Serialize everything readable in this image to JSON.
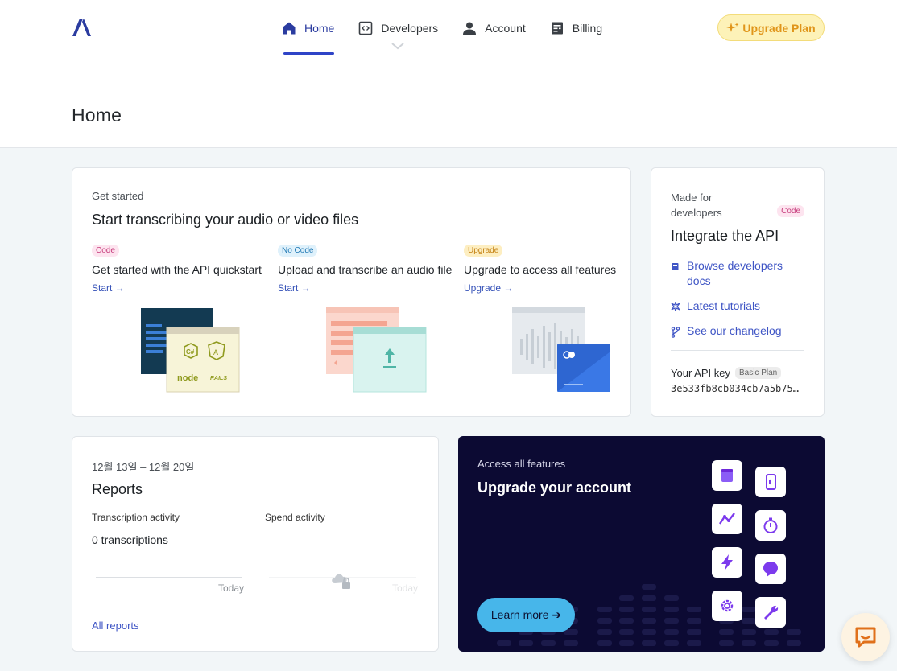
{
  "colors": {
    "brand": "#2f44c7",
    "link": "#3f55c5",
    "upgrade_bg": "#fdf2b8",
    "upgrade_text": "#e0951a",
    "promo_bg": "#0c0a33",
    "cta": "#47b6ea"
  },
  "nav": {
    "logo_icon": "assemblyai-logo-icon",
    "items": [
      {
        "label": "Home",
        "icon": "home-icon",
        "active": true
      },
      {
        "label": "Developers",
        "icon": "code-window-icon",
        "active": false
      },
      {
        "label": "Account",
        "icon": "person-icon",
        "active": false
      },
      {
        "label": "Billing",
        "icon": "receipt-icon",
        "active": false
      }
    ],
    "upgrade_label": "Upgrade Plan",
    "upgrade_icon": "sparkle-icon"
  },
  "page": {
    "title": "Home"
  },
  "get_started": {
    "eyebrow": "Get started",
    "title": "Start transcribing your audio or video files",
    "columns": [
      {
        "tag": "Code",
        "title": "Get started with the API quickstart",
        "link": "Start →"
      },
      {
        "tag": "No Code",
        "title": "Upload and transcribe an audio file",
        "link": "Start →"
      },
      {
        "tag": "Upgrade",
        "title": "Upgrade to access all features",
        "link": "Upgrade →"
      }
    ],
    "sdk_logos": [
      "C#",
      "node",
      "RAILS"
    ]
  },
  "api": {
    "eyebrow": "Made for developers",
    "tag": "Code",
    "title": "Integrate the API",
    "links": [
      {
        "label": "Browse developers docs",
        "icon": "book-icon"
      },
      {
        "label": "Latest tutorials",
        "icon": "sparkle-icon"
      },
      {
        "label": "See our changelog",
        "icon": "git-branch-icon"
      }
    ],
    "key_label": "Your API key",
    "plan_badge": "Basic Plan",
    "key_value": "3e533fb8cb034cb7a5b75…"
  },
  "reports": {
    "date_range": "12월 13일 – 12월 20일",
    "title": "Reports",
    "transcription_label": "Transcription activity",
    "transcription_count": "0 transcriptions",
    "spend_label": "Spend activity",
    "today_1": "Today",
    "today_2": "Today",
    "link": "All reports"
  },
  "upgrade_promo": {
    "eyebrow": "Access all features",
    "title": "Upgrade your account",
    "button": "Learn more ➔",
    "icons": [
      "cube-icon",
      "mobile-audio-icon",
      "trend-line-icon",
      "stopwatch-icon",
      "lightning-icon",
      "chat-icon",
      "gear-icon",
      "wrench-icon"
    ]
  },
  "support": {
    "icon": "chat-support-icon"
  }
}
